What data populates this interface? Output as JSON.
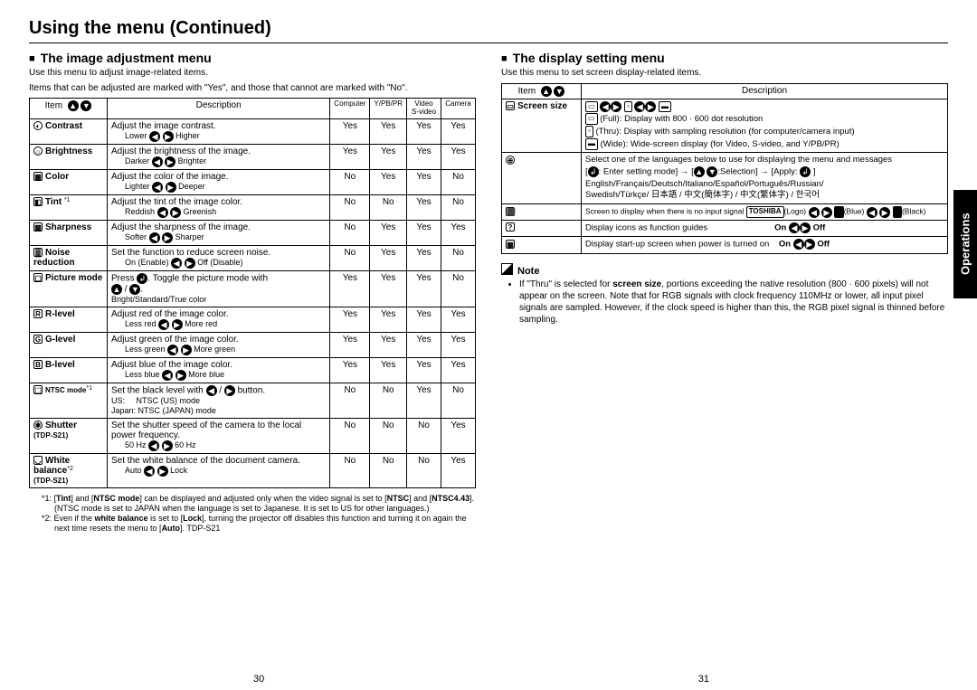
{
  "mainTitle": "Using the menu (Continued)",
  "opsTab": "Operations",
  "pageLeft": "30",
  "pageRight": "31",
  "left": {
    "heading": "The image adjustment menu",
    "intro1": "Use this menu to adjust image-related items.",
    "intro2": "Items that can be adjusted are marked with \"Yes\", and those that cannot are marked with \"No\".",
    "hdrItem": "Item",
    "hdrDesc": "Description",
    "hdrComp": "Computer",
    "hdrYpbpr": "Y/PB/PR",
    "hdrVideo": "Video S-video",
    "hdrCamera": "Camera",
    "rows": {
      "contrast": {
        "item": "Contrast",
        "desc": "Adjust the image contrast.",
        "sub1": "Lower",
        "sub2": "Higher",
        "c": "Yes",
        "y": "Yes",
        "v": "Yes",
        "cam": "Yes"
      },
      "brightness": {
        "item": "Brightness",
        "desc": "Adjust the brightness of the image.",
        "sub1": "Darker",
        "sub2": "Brighter",
        "c": "Yes",
        "y": "Yes",
        "v": "Yes",
        "cam": "Yes"
      },
      "color": {
        "item": "Color",
        "desc": "Adjust the color of the image.",
        "sub1": "Lighter",
        "sub2": "Deeper",
        "c": "No",
        "y": "Yes",
        "v": "Yes",
        "cam": "No"
      },
      "tint": {
        "item": "Tint",
        "sup": "*1",
        "desc": "Adjust the tint of the image color.",
        "sub1": "Reddish",
        "sub2": "Greenish",
        "c": "No",
        "y": "No",
        "v": "Yes",
        "cam": "No"
      },
      "sharpness": {
        "item": "Sharpness",
        "desc": "Adjust the sharpness of the image.",
        "sub1": "Softer",
        "sub2": "Sharper",
        "c": "No",
        "y": "Yes",
        "v": "Yes",
        "cam": "Yes"
      },
      "noise": {
        "item": "Noise reduction",
        "desc": "Set the function to reduce screen noise.",
        "sub1": "On (Enable)",
        "sub2": "Off (Disable)",
        "c": "No",
        "y": "Yes",
        "v": "Yes",
        "cam": "No"
      },
      "picture": {
        "item": "Picture mode",
        "desc": "Press",
        "desc2": ". Toggle the picture mode with",
        "desc3": "Bright/Standard/True color",
        "c": "Yes",
        "y": "Yes",
        "v": "Yes",
        "cam": "No"
      },
      "rlevel": {
        "item": "R-level",
        "desc": "Adjust red of the image color.",
        "sub1": "Less red",
        "sub2": "More red",
        "c": "Yes",
        "y": "Yes",
        "v": "Yes",
        "cam": "Yes"
      },
      "glevel": {
        "item": "G-level",
        "desc": "Adjust green of the image color.",
        "sub1": "Less green",
        "sub2": "More green",
        "c": "Yes",
        "y": "Yes",
        "v": "Yes",
        "cam": "Yes"
      },
      "blevel": {
        "item": "B-level",
        "desc": "Adjust blue of the image color.",
        "sub1": "Less blue",
        "sub2": "More blue",
        "c": "Yes",
        "y": "Yes",
        "v": "Yes",
        "cam": "Yes"
      },
      "ntsc": {
        "item": "NTSC mode",
        "sup": "*1",
        "desc": "Set the black level with",
        "desc2": "button.",
        "l1": "US:",
        "l1v": "NTSC (US) mode",
        "l2": "Japan:",
        "l2v": "NTSC (JAPAN) mode",
        "c": "No",
        "y": "No",
        "v": "Yes",
        "cam": "No"
      },
      "shutter": {
        "item": "Shutter",
        "model": "(TDP-S21)",
        "desc": "Set the shutter speed of the camera to the local power frequency.",
        "sub1": "50 Hz",
        "sub2": "60 Hz",
        "c": "No",
        "y": "No",
        "v": "No",
        "cam": "Yes"
      },
      "wb": {
        "item": "White balance",
        "sup": "*2",
        "model": "(TDP-S21)",
        "desc": "Set the white balance of the document camera.",
        "sub1": "Auto",
        "sub2": "Lock",
        "c": "No",
        "y": "No",
        "v": "No",
        "cam": "Yes"
      }
    },
    "fn1": "*1: [Tint] and [NTSC mode] can be displayed and adjusted only when the video signal is set to [NTSC] and [NTSC4.43]. (NTSC mode is set to JAPAN when the language is set to Japanese. It is set to US for other languages.)",
    "fn2": "*2: Even if the white balance is set to [Lock], turning the projector off disables this function and turning it on again the next time resets the menu to [Auto]. TDP-S21"
  },
  "right": {
    "heading": "The display setting menu",
    "intro": "Use this menu to set screen display-related items.",
    "hdrItem": "Item",
    "hdrDesc": "Description",
    "screenSizeLabel": "Screen size",
    "ssFull": "(Full): Display with 800 · 600 dot resolution",
    "ssThru": "(Thru): Display with sampling resolution (for computer/camera input)",
    "ssWide": "(Wide): Wide-screen display (for Video, S-video, and Y/PB/PR)",
    "langIntro": "Select one of the languages below to use for displaying the menu and messages",
    "langHint1": ": Enter setting mode] → [",
    "langHint2": ":Selection] → [Apply:",
    "langHint3": " ]",
    "langList1": "English/Français/Deutsch/Italiano/Español/Português/Russian/",
    "langList2": "Swedish/Türkçe/ 日本語 / 中文(簡体字) / 中文(繁体字) / 한국어",
    "noSignal": "Screen to display when there is no input signal",
    "noSigLogo": "(Logo)",
    "noSigBlue": "(Blue)",
    "noSigBlack": "(Black)",
    "guide": "Display icons as function guides",
    "guideOnOff1": "On",
    "guideOnOff2": "Off",
    "startup": "Display start-up screen when power is turned on",
    "startOnOff1": "On",
    "startOnOff2": "Off",
    "noteHead": "Note",
    "noteBody": "If \"Thru\" is selected for screen size, portions exceeding the native resolution (800 · 600 pixels) will not appear on the screen. Note that for RGB signals with clock frequency 110MHz or lower, all input pixel signals are sampled. However, if the clock speed is higher than this, the RGB pixel signal is thinned before sampling."
  }
}
